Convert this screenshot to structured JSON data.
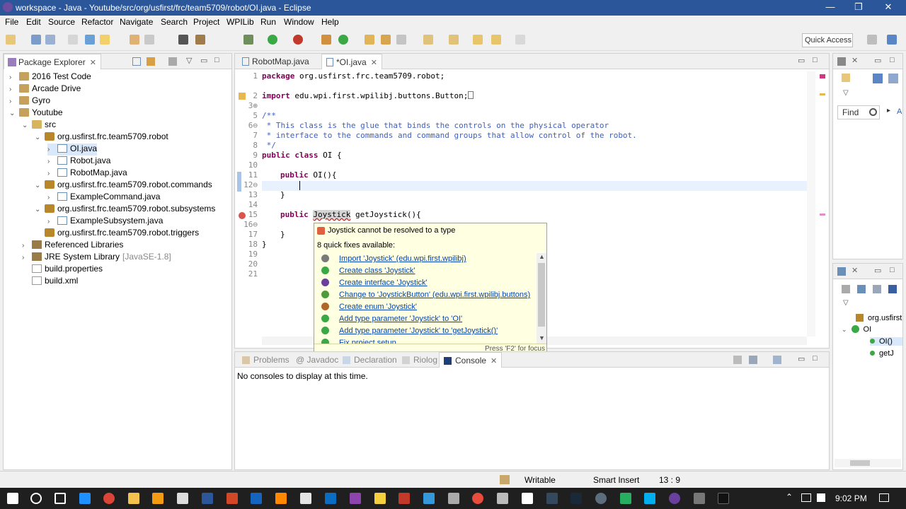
{
  "window": {
    "title": "workspace - Java - Youtube/src/org/usfirst/frc/team5709/robot/OI.java - Eclipse",
    "minimize": "—",
    "restore": "❐",
    "close": "✕"
  },
  "menu": [
    "File",
    "Edit",
    "Source",
    "Refactor",
    "Navigate",
    "Search",
    "Project",
    "WPILib",
    "Run",
    "Window",
    "Help"
  ],
  "toolbar": {
    "quick_access": "Quick Access",
    "accent": "#4a90d9"
  },
  "package_explorer": {
    "title": "Package Explorer",
    "close": "✕",
    "items": [
      {
        "label": "2016 Test Code",
        "level": 0,
        "arrow": "›",
        "icon": "project-icon"
      },
      {
        "label": "Arcade Drive",
        "level": 0,
        "arrow": "›",
        "icon": "project-icon"
      },
      {
        "label": "Gyro",
        "level": 0,
        "arrow": "›",
        "icon": "project-icon"
      },
      {
        "label": "Youtube",
        "level": 0,
        "arrow": "⌄",
        "icon": "project-icon"
      },
      {
        "label": "src",
        "level": 1,
        "arrow": "⌄",
        "icon": "source-folder-icon"
      },
      {
        "label": "org.usfirst.frc.team5709.robot",
        "level": 2,
        "arrow": "⌄",
        "icon": "package-icon"
      },
      {
        "label": "OI.java",
        "level": 3,
        "arrow": "›",
        "icon": "java-file-icon",
        "selected": true
      },
      {
        "label": "Robot.java",
        "level": 3,
        "arrow": "›",
        "icon": "java-file-icon"
      },
      {
        "label": "RobotMap.java",
        "level": 3,
        "arrow": "›",
        "icon": "java-file-icon"
      },
      {
        "label": "org.usfirst.frc.team5709.robot.commands",
        "level": 2,
        "arrow": "⌄",
        "icon": "package-icon"
      },
      {
        "label": "ExampleCommand.java",
        "level": 3,
        "arrow": "›",
        "icon": "java-file-icon"
      },
      {
        "label": "org.usfirst.frc.team5709.robot.subsystems",
        "level": 2,
        "arrow": "⌄",
        "icon": "package-icon"
      },
      {
        "label": "ExampleSubsystem.java",
        "level": 3,
        "arrow": "›",
        "icon": "java-file-icon"
      },
      {
        "label": "org.usfirst.frc.team5709.robot.triggers",
        "level": 2,
        "arrow": "",
        "icon": "package-icon"
      },
      {
        "label": "Referenced Libraries",
        "level": 1,
        "arrow": "›",
        "icon": "library-icon"
      },
      {
        "label": "JRE System Library",
        "suffix": "[JavaSE-1.8]",
        "level": 1,
        "arrow": "›",
        "icon": "library-icon"
      },
      {
        "label": "build.properties",
        "level": 1,
        "arrow": "",
        "icon": "file-icon"
      },
      {
        "label": "build.xml",
        "level": 1,
        "arrow": "",
        "icon": "file-icon"
      }
    ]
  },
  "editor": {
    "tabs": [
      {
        "label": "RobotMap.java",
        "active": false
      },
      {
        "label": "*OI.java",
        "active": true
      }
    ],
    "line_numbers": [
      "1",
      "2",
      "3⊕",
      "5",
      "6⊖",
      "7",
      "8",
      "9",
      "10",
      "11",
      "12⊖",
      "13",
      "14",
      "15",
      "16⊖",
      "17",
      "18",
      "19",
      "20",
      "21"
    ],
    "lines": {
      "l1_kw": "package",
      "l1_rest": " org.usfirst.frc.team5709.robot;",
      "l3_kw": "import",
      "l3_rest": " edu.wpi.first.wpilibj.buttons.Button;",
      "l6": "/**",
      "l7": " * This class is the glue that binds the controls on the physical operator",
      "l8": " * interface to the commands and command groups that allow control of the robot.",
      "l9": " */",
      "l10_kw": "public class",
      "l10_rest": " OI {",
      "l12_kw": "public",
      "l12_rest": " OI(){",
      "l14": "}",
      "l16_kw": "public",
      "l16_type": "Joystick",
      "l16_rest": " getJoystick(){",
      "l18": "}",
      "l19": "}"
    }
  },
  "quickfix": {
    "error": "Joystick cannot be resolved to a type",
    "count": "8 quick fixes available:",
    "fixes": [
      {
        "label": "Import 'Joystick' (edu.wpi.first.wpilibj)",
        "icon": "import-icon",
        "color": "#7a7a7a"
      },
      {
        "label": "Create class 'Joystick'",
        "icon": "class-icon",
        "color": "#3aa845"
      },
      {
        "label": "Create interface 'Joystick'",
        "icon": "interface-icon",
        "color": "#6a3f9e"
      },
      {
        "label": "Change to 'JoystickButton' (edu.wpi.first.wpilibj.buttons)",
        "icon": "change-icon",
        "color": "#4f9a3a"
      },
      {
        "label": "Create enum 'Joystick'",
        "icon": "enum-icon",
        "color": "#b0672a"
      },
      {
        "label": "Add type parameter 'Joystick' to 'OI'",
        "icon": "type-param-icon",
        "color": "#3aa845"
      },
      {
        "label": "Add type parameter 'Joystick' to 'getJoystick()'",
        "icon": "type-param-icon",
        "color": "#3aa845"
      },
      {
        "label": "Fix project setup...",
        "icon": "setup-icon",
        "color": "#3aa845"
      }
    ],
    "footer": "Press 'F2' for focus"
  },
  "bottom_panel": {
    "tabs": [
      "Problems",
      "Javadoc",
      "Declaration",
      "Riolog",
      "Console"
    ],
    "active": "Console",
    "message": "No consoles to display at this time."
  },
  "right_panel": {
    "find_placeholder": "Find",
    "all_label": "A",
    "outline_items": [
      "org.usfirst",
      "OI",
      "OI()",
      "getJ"
    ]
  },
  "status": {
    "writable": "Writable",
    "insert": "Smart Insert",
    "position": "13 : 9"
  },
  "taskbar": {
    "clock": "9:02 PM"
  }
}
